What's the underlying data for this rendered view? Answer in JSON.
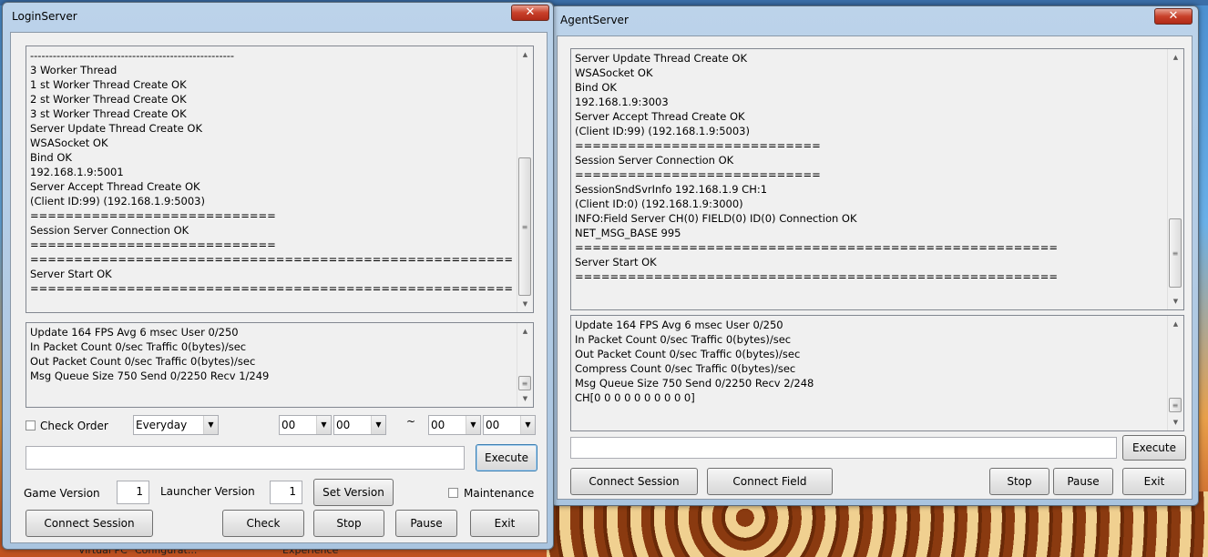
{
  "login": {
    "title": "LoginServer",
    "log_lines": [
      "------------------------------------------------------",
      "3 Worker Thread",
      "1 st Worker Thread Create OK",
      "2 st Worker Thread Create OK",
      "3 st Worker Thread Create OK",
      "Server Update Thread Create OK",
      "WSASocket OK",
      "Bind OK",
      "192.168.1.9:5001",
      "Server Accept Thread Create OK",
      "(Client ID:99) (192.168.1.9:5003)",
      "============================",
      "Session Server Connection OK",
      "============================",
      "=======================================================",
      "Server Start OK",
      "======================================================="
    ],
    "status_lines": [
      "Update 164 FPS Avg 6 msec User 0/250",
      "In Packet Count 0/sec Traffic 0(bytes)/sec",
      "Out Packet Count 0/sec Traffic 0(bytes)/sec",
      "Msg Queue Size 750 Send 0/2250 Recv 1/249"
    ],
    "check_order_label": "Check Order",
    "schedule_select": "Everyday",
    "time_from_hour": "00",
    "time_from_min": "00",
    "tilde": "~",
    "time_to_hour": "00",
    "time_to_min": "00",
    "command_value": "",
    "execute_label": "Execute",
    "game_version_label": "Game Version",
    "game_version_value": "1",
    "launcher_version_label": "Launcher Version",
    "launcher_version_value": "1",
    "set_version_label": "Set Version",
    "maintenance_label": "Maintenance",
    "buttons": {
      "connect_session": "Connect Session",
      "check": "Check",
      "stop": "Stop",
      "pause": "Pause",
      "exit": "Exit"
    }
  },
  "agent": {
    "title": "AgentServer",
    "log_lines": [
      "Server Update Thread Create OK",
      "WSASocket OK",
      "Bind OK",
      "192.168.1.9:3003",
      "Server Accept Thread Create OK",
      "(Client ID:99) (192.168.1.9:5003)",
      "============================",
      "Session Server Connection OK",
      "============================",
      "SessionSndSvrInfo 192.168.1.9 CH:1",
      "(Client ID:0) (192.168.1.9:3000)",
      "INFO:Field Server CH(0) FIELD(0) ID(0) Connection OK",
      "NET_MSG_BASE 995",
      "=======================================================",
      "Server Start OK",
      "======================================================="
    ],
    "status_lines": [
      "Update 164 FPS Avg 6 msec User 0/250",
      "In Packet Count 0/sec Traffic 0(bytes)/sec",
      "Out Packet Count 0/sec Traffic 0(bytes)/sec",
      "Compress Count 0/sec Traffic 0(bytes)/sec",
      "Msg Queue Size 750 Send 0/2250 Recv 2/248",
      "CH[0 0 0 0 0 0 0 0 0 0]"
    ],
    "command_value": "",
    "execute_label": "Execute",
    "buttons": {
      "connect_session": "Connect Session",
      "connect_field": "Connect Field",
      "stop": "Stop",
      "pause": "Pause",
      "exit": "Exit"
    }
  },
  "close_glyph": "✕",
  "desktop_labels": [
    "Virtual PC",
    "Configurat...",
    "Experience"
  ]
}
